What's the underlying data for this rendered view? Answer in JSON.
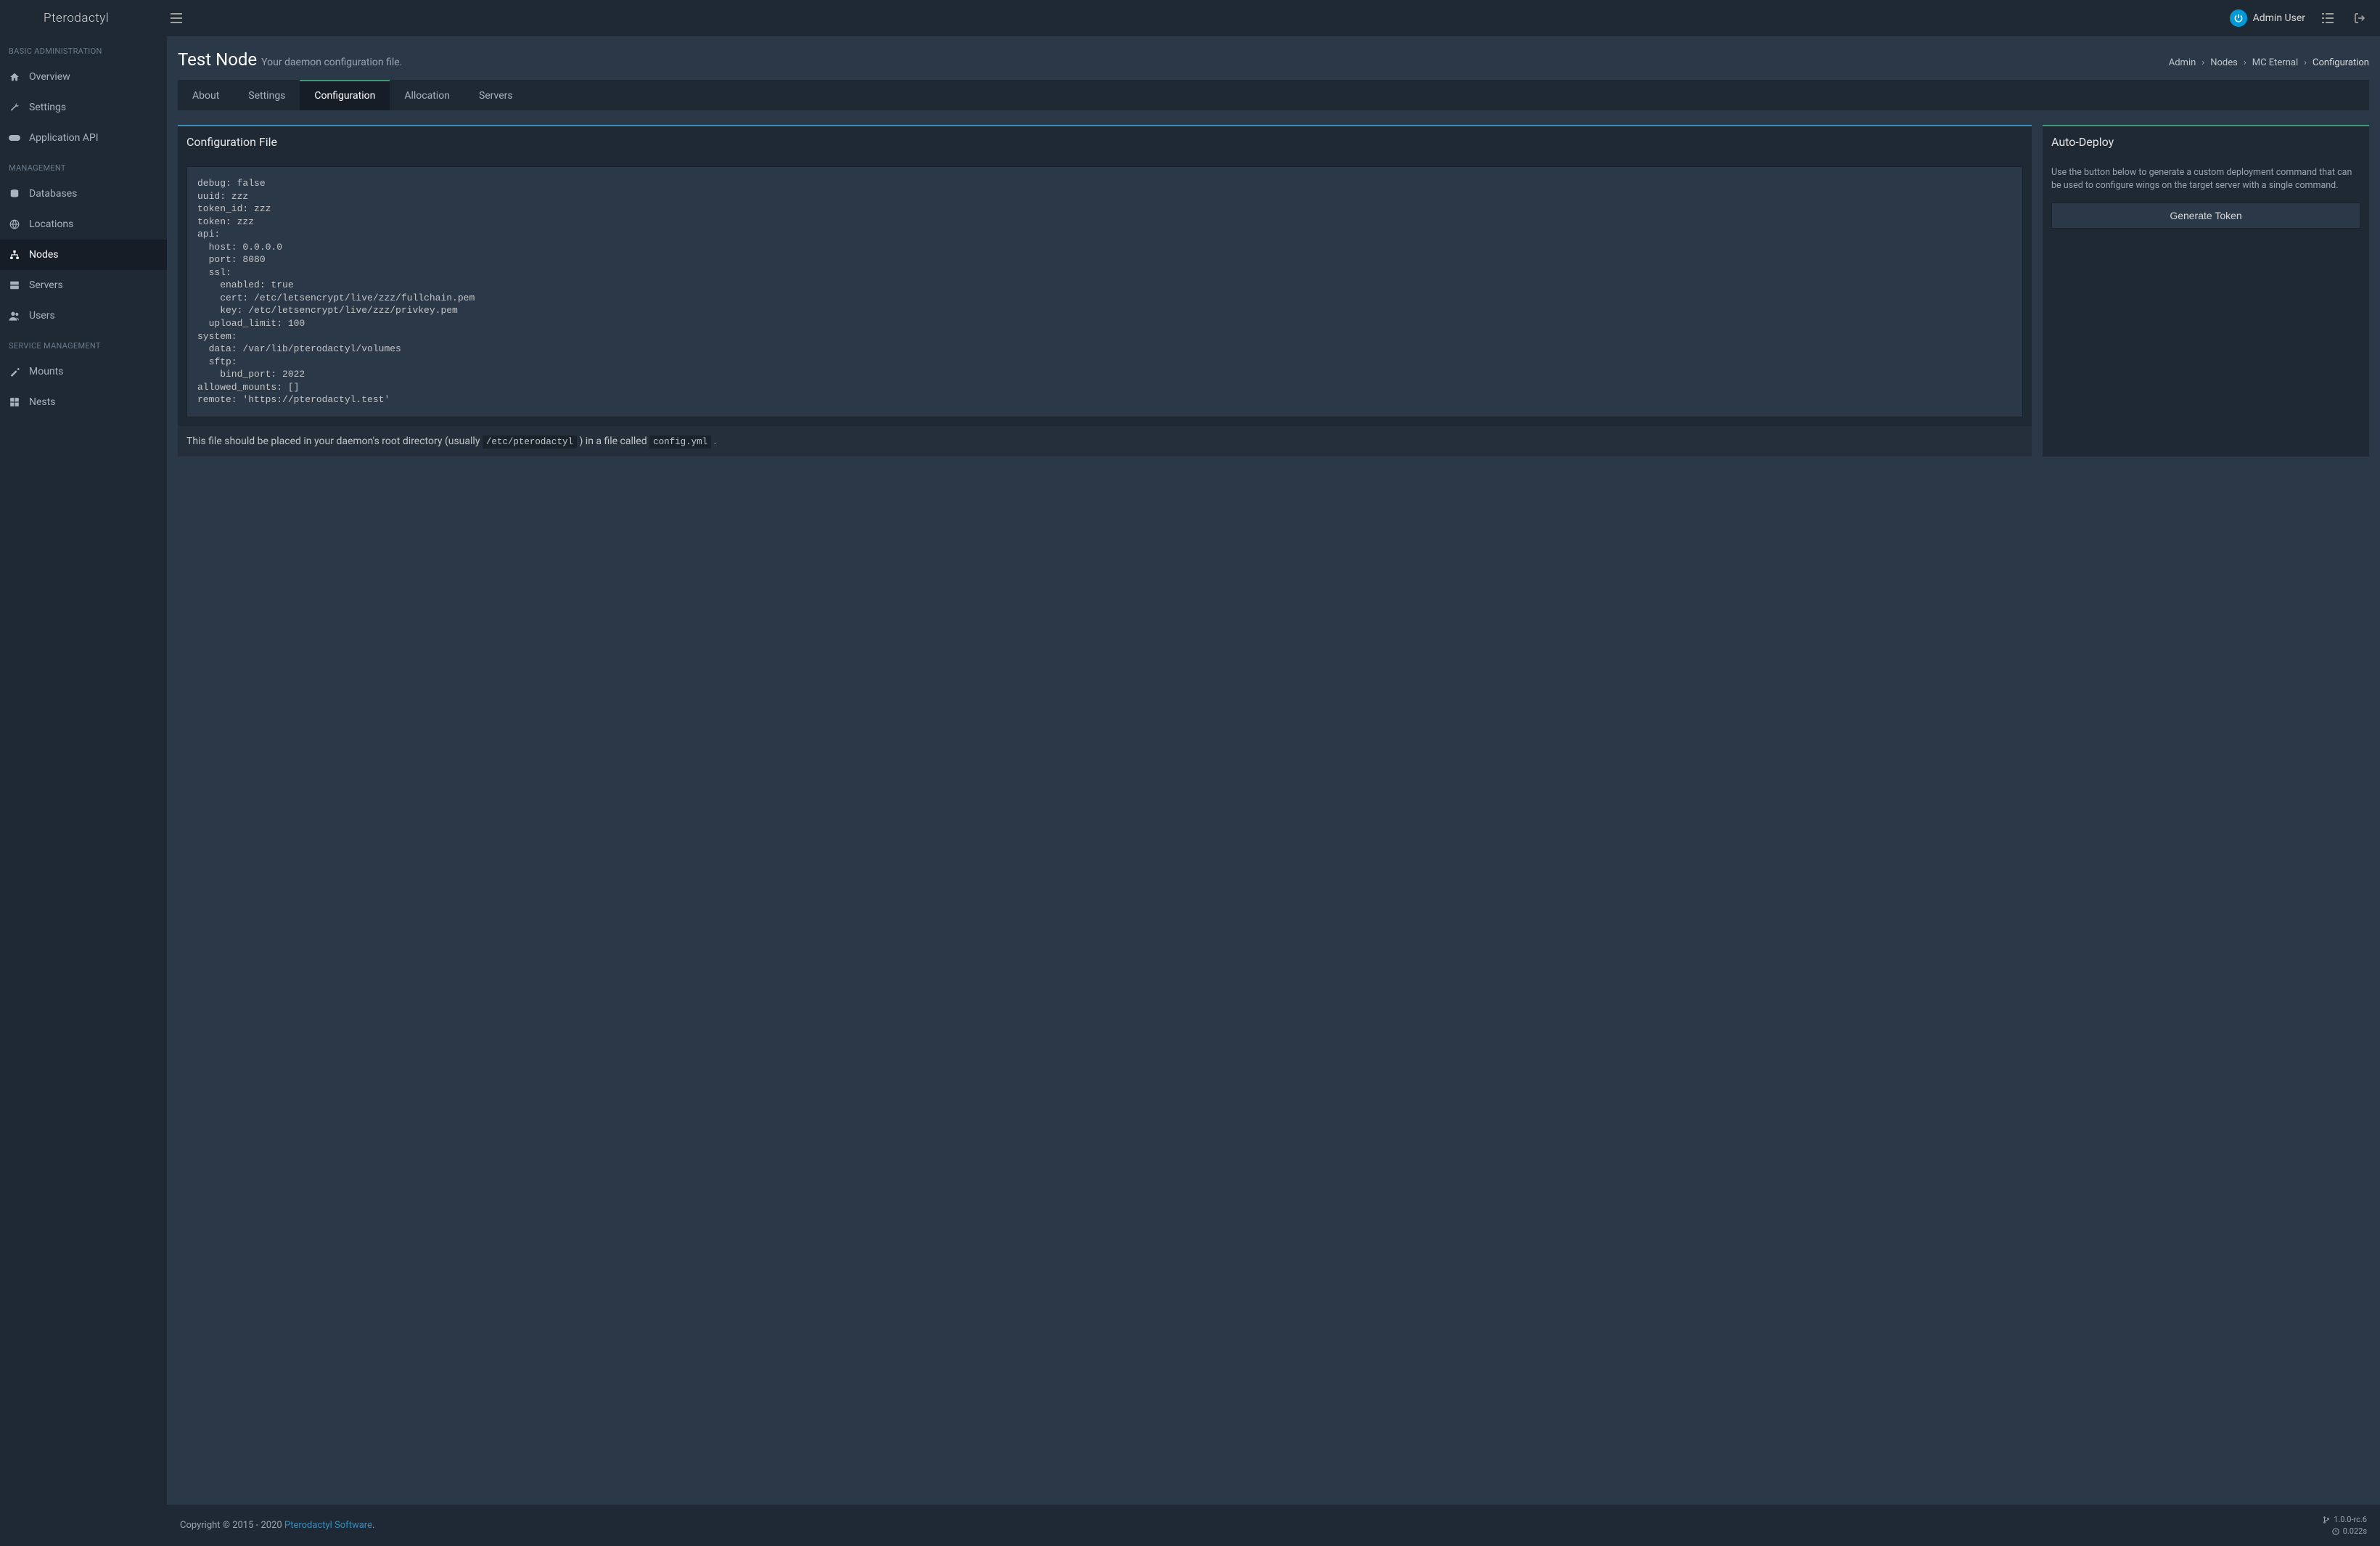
{
  "brand": {
    "name": "Pterodactyl"
  },
  "topbar": {
    "user_name": "Admin User"
  },
  "sidebar": {
    "sections": [
      {
        "title": "BASIC ADMINISTRATION"
      },
      {
        "title": "MANAGEMENT"
      },
      {
        "title": "SERVICE MANAGEMENT"
      }
    ],
    "items": {
      "overview": "Overview",
      "settings": "Settings",
      "api": "Application API",
      "databases": "Databases",
      "locations": "Locations",
      "nodes": "Nodes",
      "servers": "Servers",
      "users": "Users",
      "mounts": "Mounts",
      "nests": "Nests"
    }
  },
  "page": {
    "title": "Test Node",
    "subtitle": "Your daemon configuration file."
  },
  "breadcrumb": {
    "admin": "Admin",
    "nodes": "Nodes",
    "mc": "MC Eternal",
    "current": "Configuration"
  },
  "tabs": {
    "about": "About",
    "settings": "Settings",
    "configuration": "Configuration",
    "allocation": "Allocation",
    "servers": "Servers"
  },
  "config_panel": {
    "title": "Configuration File",
    "content": "debug: false\nuuid: zzz\ntoken_id: zzz\ntoken: zzz\napi:\n  host: 0.0.0.0\n  port: 8080\n  ssl:\n    enabled: true\n    cert: /etc/letsencrypt/live/zzz/fullchain.pem\n    key: /etc/letsencrypt/live/zzz/privkey.pem\n  upload_limit: 100\nsystem:\n  data: /var/lib/pterodactyl/volumes\n  sftp:\n    bind_port: 2022\nallowed_mounts: []\nremote: 'https://pterodactyl.test'",
    "footer_text_a": "This file should be placed in your daemon's root directory (usually ",
    "footer_code_a": "/etc/pterodactyl",
    "footer_text_b": " ) in a file called ",
    "footer_code_b": "config.yml",
    "footer_text_c": " ."
  },
  "deploy_panel": {
    "title": "Auto-Deploy",
    "help": "Use the button below to generate a custom deployment command that can be used to configure wings on the target server with a single command.",
    "button": "Generate Token"
  },
  "footer": {
    "copyright_a": "Copyright © 2015 - 2020 ",
    "link": "Pterodactyl Software",
    "copyright_b": ".",
    "version": "1.0.0-rc.6",
    "time": "0.022s"
  }
}
